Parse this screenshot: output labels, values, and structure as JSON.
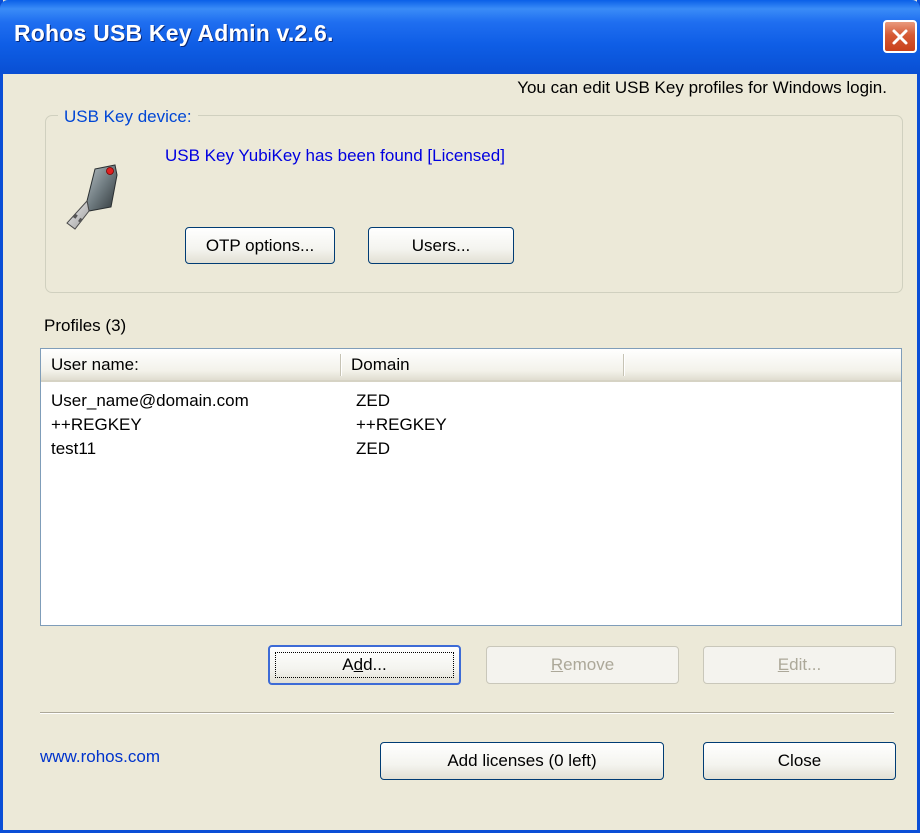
{
  "window": {
    "title": "Rohos USB Key Admin v.2.6.",
    "hint": "You can edit USB Key profiles for Windows login."
  },
  "device": {
    "group_label": "USB Key device:",
    "status_message": "USB Key YubiKey has been found [Licensed]",
    "otp_button": "OTP options...",
    "users_button": "Users..."
  },
  "profiles": {
    "label": "Profiles (3)",
    "columns": [
      "User name:",
      "Domain",
      ""
    ],
    "rows": [
      {
        "user": "User_name@domain.com",
        "domain": "ZED"
      },
      {
        "user": "++REGKEY",
        "domain": "++REGKEY"
      },
      {
        "user": "test11",
        "domain": "ZED"
      }
    ]
  },
  "actions": {
    "add": {
      "pre": "A",
      "accel": "d",
      "post": "d...",
      "enabled": true
    },
    "remove": {
      "pre": "",
      "accel": "R",
      "post": "emove",
      "enabled": false
    },
    "edit": {
      "pre": "",
      "accel": "E",
      "post": "dit...",
      "enabled": false
    }
  },
  "footer": {
    "website": "www.rohos.com",
    "add_licenses_button": "Add licenses (0 left)",
    "close_button": "Close"
  },
  "colors": {
    "titlebar": "#0a5fe8",
    "group_label": "#0046d5",
    "status_message": "#0000e0",
    "link": "#0033cc",
    "close_button": "#d65a35"
  },
  "icons": {
    "device": "usb-key-icon",
    "close": "close-icon"
  }
}
